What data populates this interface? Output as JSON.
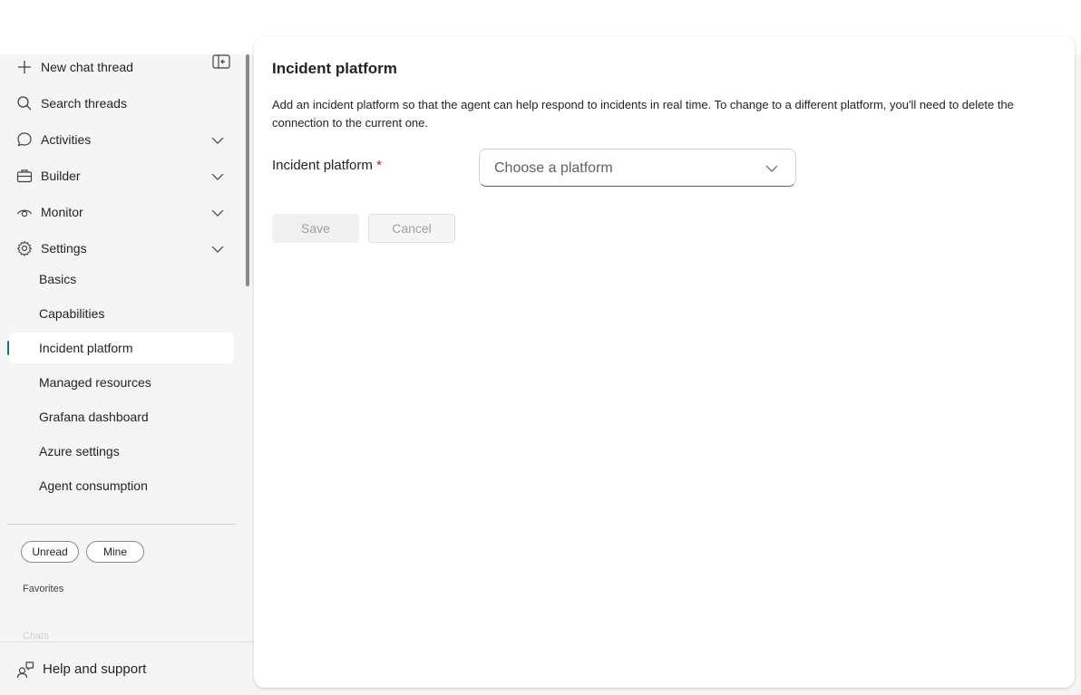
{
  "sidebar": {
    "new_chat": "New chat thread",
    "search": "Search threads",
    "nav": [
      {
        "label": "Activities",
        "icon": "chat-bubble-icon"
      },
      {
        "label": "Builder",
        "icon": "briefcase-icon"
      },
      {
        "label": "Monitor",
        "icon": "eye-icon"
      },
      {
        "label": "Settings",
        "icon": "gear-icon"
      }
    ],
    "settings_items": [
      "Basics",
      "Capabilities",
      "Incident platform",
      "Managed resources",
      "Grafana dashboard",
      "Azure settings",
      "Agent consumption"
    ],
    "active_item": "Incident platform",
    "filters": [
      "Unread",
      "Mine"
    ],
    "favorites_label": "Favorites",
    "chats_label": "Chats",
    "help": "Help and support"
  },
  "main": {
    "title": "Incident platform",
    "description": "Add an incident platform so that the agent can help respond to incidents in real time. To change to a different platform, you'll need to delete the connection to the current one.",
    "field_label": "Incident platform",
    "required_mark": "*",
    "dropdown_placeholder": "Choose a platform",
    "save_label": "Save",
    "cancel_label": "Cancel"
  },
  "colors": {
    "accent": "#0f6cbd",
    "required": "#c50f1f",
    "background": "#f5f5f5"
  }
}
